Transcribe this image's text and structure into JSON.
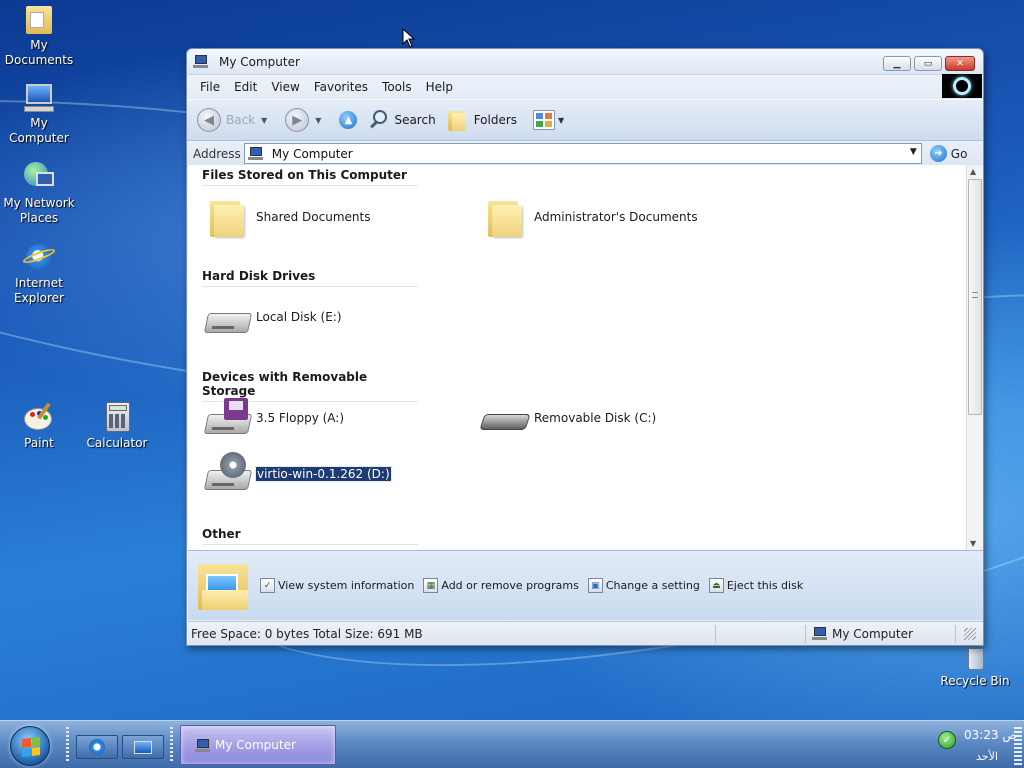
{
  "desktop": {
    "icons": [
      {
        "label": "My Documents"
      },
      {
        "label": "My Computer"
      },
      {
        "label": "My Network Places"
      },
      {
        "label": "Internet Explorer"
      },
      {
        "label": "Paint"
      },
      {
        "label": "Calculator"
      },
      {
        "label": "Recycle Bin"
      }
    ]
  },
  "window": {
    "title": "My Computer",
    "menu": [
      "File",
      "Edit",
      "View",
      "Favorites",
      "Tools",
      "Help"
    ],
    "toolbar": {
      "back": "Back",
      "search": "Search",
      "folders": "Folders"
    },
    "address": {
      "label": "Address",
      "value": "My Computer",
      "go": "Go"
    },
    "groups": {
      "files": {
        "header": "Files Stored on This Computer",
        "items": [
          "Shared Documents",
          "Administrator's Documents"
        ]
      },
      "hdd": {
        "header": "Hard Disk Drives",
        "items": [
          "Local Disk (E:)"
        ]
      },
      "removable": {
        "header": "Devices with Removable Storage",
        "items": [
          "3.5 Floppy (A:)",
          "Removable Disk (C:)",
          "virtio-win-0.1.262 (D:)"
        ]
      },
      "other": {
        "header": "Other"
      }
    },
    "tasks": [
      "View system information",
      "Add or remove programs",
      "Change a setting",
      "Eject this disk"
    ],
    "status": {
      "left": "Free Space: 0 bytes Total Size: 691 MB",
      "right": "My Computer"
    }
  },
  "taskbar": {
    "active_task": "My Computer",
    "clock_time": "03:23 ص",
    "clock_day": "الأحد"
  }
}
